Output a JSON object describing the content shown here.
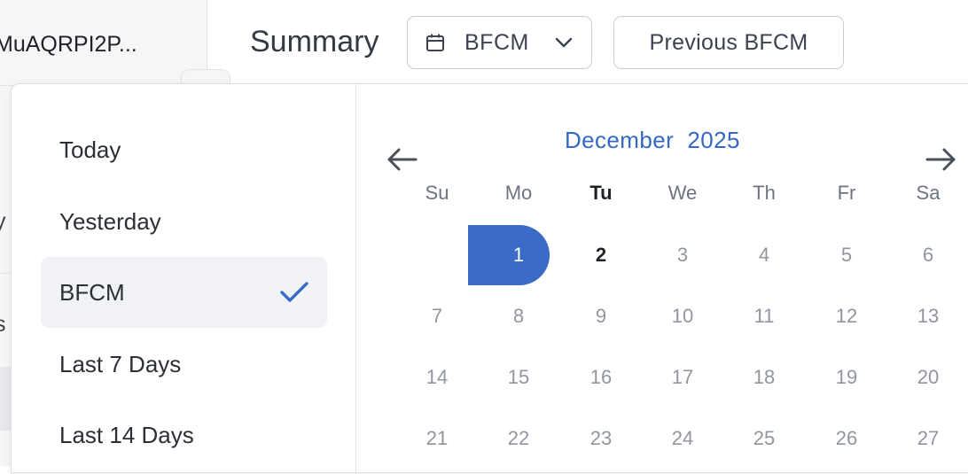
{
  "sidebar": {
    "account_name": "MuAQRPI2P...",
    "fragment_1": "y",
    "fragment_2": "s"
  },
  "header": {
    "title": "Summary",
    "range_select": {
      "label": "BFCM",
      "icon": "calendar-icon",
      "chevron": "chevron-down-icon"
    },
    "compare_button": "Previous BFCM"
  },
  "presets": [
    {
      "label": "Today",
      "selected": false
    },
    {
      "label": "Yesterday",
      "selected": false
    },
    {
      "label": "BFCM",
      "selected": true
    },
    {
      "label": "Last 7 Days",
      "selected": false
    },
    {
      "label": "Last 14 Days",
      "selected": false
    }
  ],
  "calendar": {
    "month": "December",
    "year": "2025",
    "prev_icon": "arrow-left-icon",
    "next_icon": "arrow-right-icon",
    "weekdays": [
      "Su",
      "Mo",
      "Tu",
      "We",
      "Th",
      "Fr",
      "Sa"
    ],
    "today_weekday": "Tu",
    "selected_day": "1",
    "today_day": "2",
    "weeks": [
      [
        "",
        "1",
        "2",
        "3",
        "4",
        "5",
        "6"
      ],
      [
        "7",
        "8",
        "9",
        "10",
        "11",
        "12",
        "13"
      ],
      [
        "14",
        "15",
        "16",
        "17",
        "18",
        "19",
        "20"
      ],
      [
        "21",
        "22",
        "23",
        "24",
        "25",
        "26",
        "27"
      ]
    ]
  },
  "colors": {
    "accent": "#3a6cc7",
    "month_title": "#3567c4",
    "selected_bg": "#f1f2f5"
  }
}
